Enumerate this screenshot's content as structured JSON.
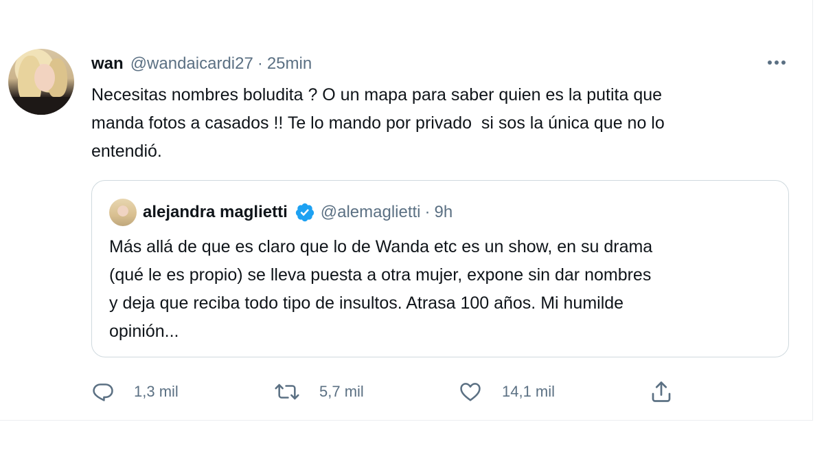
{
  "tweet": {
    "author_name": "wan",
    "author_handle": "@wandaicardi27",
    "separator": "·",
    "time": "25min",
    "text": "Necesitas nombres boludita ? O un mapa para saber quien es la putita que\nmanda fotos a casados !! Te lo mando por privado  si sos la única que no lo\nentendió.",
    "more_icon": "more-horizontal-icon"
  },
  "quoted_tweet": {
    "author_name": "alejandra maglietti",
    "verified_icon": "verified-badge-icon",
    "author_handle": "@alemaglietti",
    "separator": "·",
    "time": "9h",
    "text": "Más allá de que es claro que lo de Wanda etc es un show, en su drama\n(qué le es propio) se lleva puesta a otra mujer, expone sin dar nombres\ny deja que reciba todo tipo de insultos. Atrasa 100 años. Mi humilde\nopinión..."
  },
  "actions": {
    "reply": {
      "icon": "reply-icon",
      "count": "1,3 mil"
    },
    "retweet": {
      "icon": "retweet-icon",
      "count": "5,7 mil"
    },
    "like": {
      "icon": "heart-icon",
      "count": "14,1 mil"
    },
    "share": {
      "icon": "share-icon"
    }
  },
  "colors": {
    "text_primary": "#0f1419",
    "text_secondary": "#5b7083",
    "verified_blue": "#1da1f2",
    "border": "#cfd9de"
  }
}
